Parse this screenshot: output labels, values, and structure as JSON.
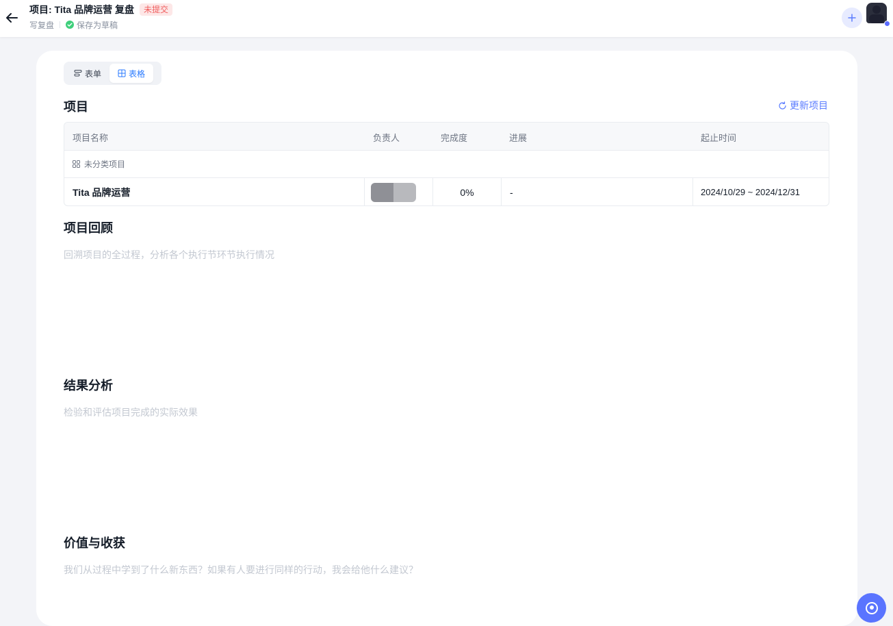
{
  "header": {
    "title": "项目: Tita 品牌运营 复盘",
    "status_badge": "未提交",
    "breadcrumb": "写复盘",
    "save_status": "保存为草稿"
  },
  "view_switch": {
    "form_label": "表单",
    "table_label": "表格",
    "active": "表格"
  },
  "project_section": {
    "title": "项目",
    "update_label": "更新项目",
    "table": {
      "columns": [
        "项目名称",
        "负责人",
        "完成度",
        "进展",
        "起止时间"
      ],
      "group_label": "未分类项目",
      "rows": [
        {
          "name": "Tita 品牌运营",
          "owner": "",
          "completion": "0%",
          "progress": "-",
          "date_range": "2024/10/29 ~ 2024/12/31"
        }
      ]
    }
  },
  "sections": [
    {
      "title": "项目回顾",
      "placeholder": "回溯项目的全过程，分析各个执行节环节执行情况"
    },
    {
      "title": "结果分析",
      "placeholder": "检验和评估项目完成的实际效果"
    },
    {
      "title": "价值与收获",
      "placeholder": "我们从过程中学到了什么新东西？如果有人要进行同样的行动，我会给他什么建议？"
    }
  ],
  "colors": {
    "accent": "#5b7cff",
    "status_red": "#f05e5e",
    "success_green": "#3fcf7b"
  }
}
